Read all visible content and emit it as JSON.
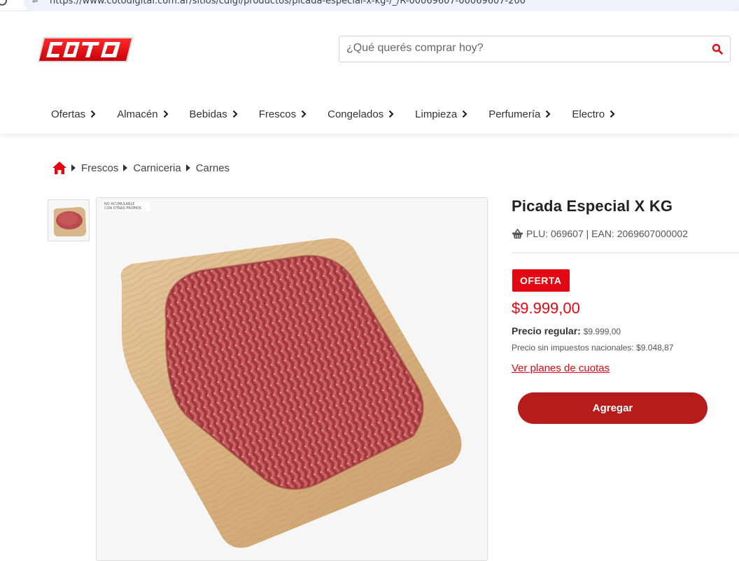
{
  "browser": {
    "url": "https://www.cotodigital.com.ar/sitios/cdigi/productos/picada-especial-x-kg-/_/R-00069607-00069607-200"
  },
  "header": {
    "logo_text": "COTO",
    "search_placeholder": "¿Qué querés comprar hoy?",
    "accent_color": "#e30613"
  },
  "nav": {
    "items": [
      {
        "label": "Ofertas"
      },
      {
        "label": "Almacén"
      },
      {
        "label": "Bebidas"
      },
      {
        "label": "Frescos"
      },
      {
        "label": "Congelados"
      },
      {
        "label": "Limpieza"
      },
      {
        "label": "Perfumería"
      },
      {
        "label": "Electro"
      }
    ]
  },
  "breadcrumb": {
    "items": [
      "Frescos",
      "Carniceria",
      "Carnes"
    ]
  },
  "product": {
    "image_badge_line1": "NO ACUMULABLE",
    "image_badge_line2": "CON OTRAS PROMOS",
    "title": "Picada Especial X KG",
    "codes": "PLU: 069607 | EAN: 2069607000002",
    "offer_badge": "OFERTA",
    "price": "$9.999,00",
    "regular_label": "Precio regular:",
    "regular_value": "$9.999,00",
    "no_tax": "Precio sin impuestos nacionales: $9.048,87",
    "installments_link": "Ver planes de cuotas",
    "add_button": "Agregar"
  }
}
